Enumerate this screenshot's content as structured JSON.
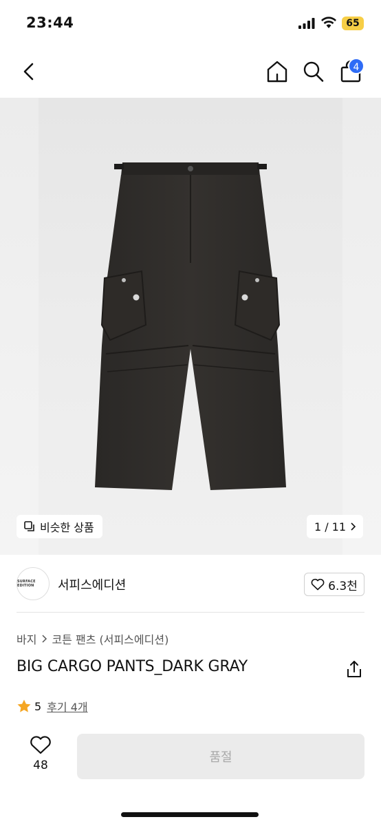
{
  "status_bar": {
    "time": "23:44",
    "battery": "65",
    "icons": [
      "signal-icon",
      "wifi-icon",
      "battery-icon"
    ]
  },
  "nav": {
    "icons": [
      "back-icon",
      "home-icon",
      "search-icon",
      "cart-icon"
    ],
    "cart_count": "4"
  },
  "gallery": {
    "similar_label": "비슷한 상품",
    "page_indicator": "1 / 11"
  },
  "brand": {
    "logo_text": "SURFACE EDITION",
    "name": "서피스에디션",
    "like_count": "6.3천"
  },
  "breadcrumb": {
    "items": [
      "바지",
      "코튼 팬츠 (서피스에디션)"
    ]
  },
  "product": {
    "title": "BIG CARGO PANTS_DARK GRAY",
    "rating": "5",
    "review_label": "후기 4개"
  },
  "bottom_bar": {
    "wish_count": "48",
    "soldout_label": "품절"
  },
  "colors": {
    "badge": "#2f6cf6",
    "battery": "#f7ce46",
    "star": "#f5a623",
    "disabled_button": "#ebebeb"
  }
}
